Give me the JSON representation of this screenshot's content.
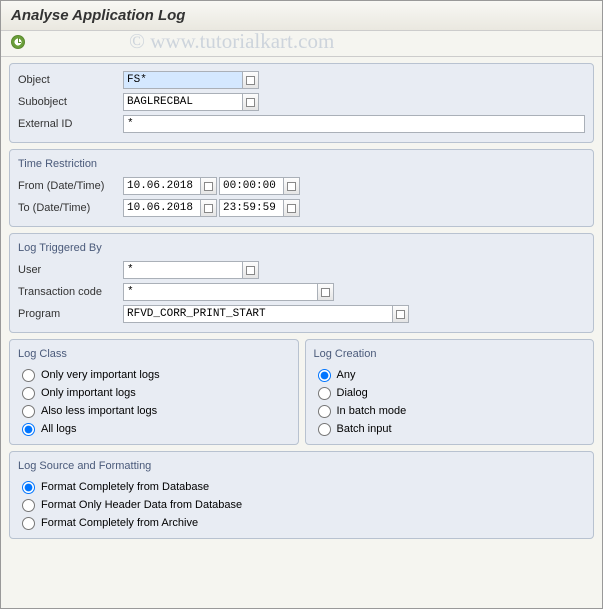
{
  "title": "Analyse Application Log",
  "watermark": "© www.tutorialkart.com",
  "group1": {
    "object_label": "Object",
    "object_value": "FS*",
    "subobject_label": "Subobject",
    "subobject_value": "BAGLRECBAL",
    "external_id_label": "External ID",
    "external_id_value": "*"
  },
  "time_restriction": {
    "title": "Time Restriction",
    "from_label": "From (Date/Time)",
    "from_date": "10.06.2018",
    "from_time": "00:00:00",
    "to_label": "To (Date/Time)",
    "to_date": "10.06.2018",
    "to_time": "23:59:59"
  },
  "log_triggered": {
    "title": "Log Triggered By",
    "user_label": "User",
    "user_value": "*",
    "tcode_label": "Transaction code",
    "tcode_value": "*",
    "program_label": "Program",
    "program_value": "RFVD_CORR_PRINT_START"
  },
  "log_class": {
    "title": "Log Class",
    "opt1": "Only very important logs",
    "opt2": "Only important logs",
    "opt3": "Also less important logs",
    "opt4": "All logs"
  },
  "log_creation": {
    "title": "Log Creation",
    "opt1": "Any",
    "opt2": "Dialog",
    "opt3": "In batch mode",
    "opt4": "Batch input"
  },
  "log_source": {
    "title": "Log Source and Formatting",
    "opt1": "Format Completely from Database",
    "opt2": "Format Only Header Data from Database",
    "opt3": "Format Completely from Archive"
  }
}
